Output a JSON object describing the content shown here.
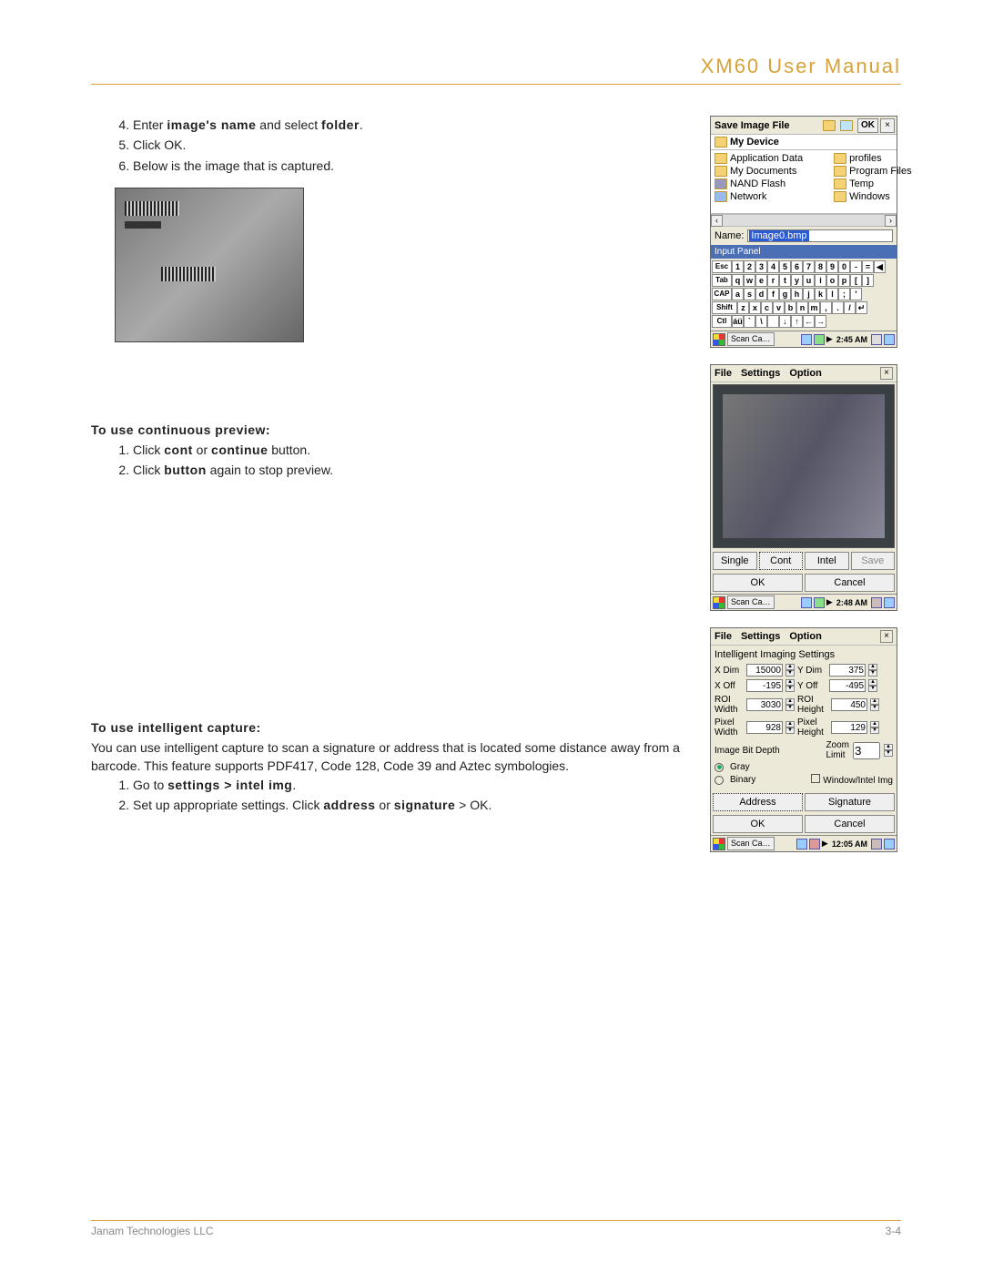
{
  "header": {
    "title": "XM60 User Manual"
  },
  "footer": {
    "company": "Janam Technologies LLC",
    "page": "3-4"
  },
  "section1": {
    "start": 4,
    "steps": [
      "Enter image's name and select folder.",
      "Click OK.",
      "Below is the image that is captured."
    ]
  },
  "section2": {
    "heading": "To use continuous preview:",
    "steps": [
      "Click cont or continue button.",
      "Click button again to stop preview."
    ],
    "bold1": "cont",
    "bold1b": "continue",
    "bold2": "button"
  },
  "section3": {
    "heading": "To use intelligent capture:",
    "intro": "You can use intelligent capture to scan a signature or address that is located some distance away from a barcode. This feature supports PDF417, Code 128, Code 39 and Aztec symbologies.",
    "steps_label1_a": "Go to ",
    "steps_label1_b": "settings > intel img",
    "steps_label1_c": ".",
    "steps_label2_a": "Set up appropriate settings. Click ",
    "steps_label2_b": "address",
    "steps_label2_c": " or ",
    "steps_label2_d": "signature",
    "steps_label2_e": " > OK."
  },
  "win_save": {
    "title": "Save Image File",
    "ok": "OK",
    "my_device": "My Device",
    "folders_left": [
      "Application Data",
      "My Documents",
      "NAND Flash",
      "Network"
    ],
    "folders_right": [
      "profiles",
      "Program Files",
      "Temp",
      "Windows"
    ],
    "name_label": "Name:",
    "name_value": "Image0.bmp",
    "input_panel": "Input Panel",
    "kb_row1": [
      "Esc",
      "1",
      "2",
      "3",
      "4",
      "5",
      "6",
      "7",
      "8",
      "9",
      "0",
      "-",
      "=",
      "◀"
    ],
    "kb_row2": [
      "Tab",
      "q",
      "w",
      "e",
      "r",
      "t",
      "y",
      "u",
      "i",
      "o",
      "p",
      "[",
      "]"
    ],
    "kb_row3": [
      "CAP",
      "a",
      "s",
      "d",
      "f",
      "g",
      "h",
      "j",
      "k",
      "l",
      ";",
      "'"
    ],
    "kb_row4": [
      "Shift",
      "z",
      "x",
      "c",
      "v",
      "b",
      "n",
      "m",
      ",",
      ".",
      "/",
      "↵"
    ],
    "kb_row5": [
      "Ctl",
      "áü",
      "`",
      "\\",
      " ",
      "↓",
      "↑",
      "←",
      "→"
    ],
    "task": "Scan Ca…",
    "clock": "2:45 AM"
  },
  "win_preview": {
    "menu": [
      "File",
      "Settings",
      "Option"
    ],
    "buttons": {
      "single": "Single",
      "cont": "Cont",
      "intel": "Intel",
      "save": "Save",
      "ok": "OK",
      "cancel": "Cancel"
    },
    "task": "Scan Ca…",
    "clock": "2:48 AM"
  },
  "win_settings": {
    "menu": [
      "File",
      "Settings",
      "Option"
    ],
    "title": "Intelligent Imaging Settings",
    "xdim_label": "X Dim",
    "xdim": "15000",
    "ydim_label": "Y Dim",
    "ydim": "375",
    "xoff_label": "X Off",
    "xoff": "-195",
    "yoff_label": "Y Off",
    "yoff": "-495",
    "roiw_label": "ROI Width",
    "roiw": "3030",
    "roih_label": "ROI Height",
    "roih": "450",
    "pixw_label": "Pixel Width",
    "pixw": "928",
    "pixh_label": "Pixel Height",
    "pixh": "129",
    "bitdepth_label": "Image Bit Depth",
    "gray": "Gray",
    "binary": "Binary",
    "zoom_label": "Zoom Limit",
    "zoom": "3",
    "winintel": "Window/Intel Img",
    "address": "Address",
    "signature": "Signature",
    "ok": "OK",
    "cancel": "Cancel",
    "task": "Scan Ca…",
    "clock": "12:05 AM"
  }
}
